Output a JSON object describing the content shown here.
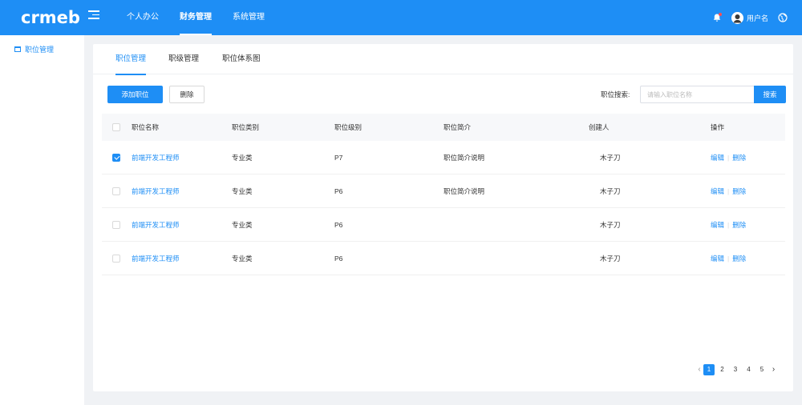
{
  "header": {
    "logo": "crmeb",
    "nav": [
      "个人办公",
      "财务管理",
      "系统管理"
    ],
    "active_nav": 1,
    "username": "用户名"
  },
  "sidebar": {
    "items": [
      {
        "label": "职位管理"
      }
    ]
  },
  "tabs": [
    "职位管理",
    "职级管理",
    "职位体系图"
  ],
  "toolbar": {
    "add_label": "添加职位",
    "delete_label": "删除",
    "search_label": "职位搜索:",
    "search_placeholder": "请输入职位名称",
    "search_value": "",
    "search_button": "搜索"
  },
  "table": {
    "columns": [
      "职位名称",
      "职位类别",
      "职位级别",
      "职位简介",
      "创建人",
      "操作"
    ],
    "rows": [
      {
        "checked": true,
        "name": "前端开发工程师",
        "category": "专业类",
        "level": "P7",
        "intro": "职位简介说明",
        "creator": "木子刀",
        "edit": "编辑",
        "delete": "删除"
      },
      {
        "checked": false,
        "name": "前端开发工程师",
        "category": "专业类",
        "level": "P6",
        "intro": "职位简介说明",
        "creator": "木子刀",
        "edit": "编辑",
        "delete": "删除"
      },
      {
        "checked": false,
        "name": "前端开发工程师",
        "category": "专业类",
        "level": "P6",
        "intro": "",
        "creator": "木子刀",
        "edit": "编辑",
        "delete": "删除"
      },
      {
        "checked": false,
        "name": "前端开发工程师",
        "category": "专业类",
        "level": "P6",
        "intro": "",
        "creator": "木子刀",
        "edit": "编辑",
        "delete": "删除"
      }
    ]
  },
  "pagination": {
    "pages": [
      "1",
      "2",
      "3",
      "4",
      "5"
    ],
    "current": "1",
    "prev_icon": "chevron-left-icon",
    "next_icon": "chevron-right-icon"
  },
  "colors": {
    "primary": "#1e8ef5",
    "background": "#f0f2f5"
  }
}
